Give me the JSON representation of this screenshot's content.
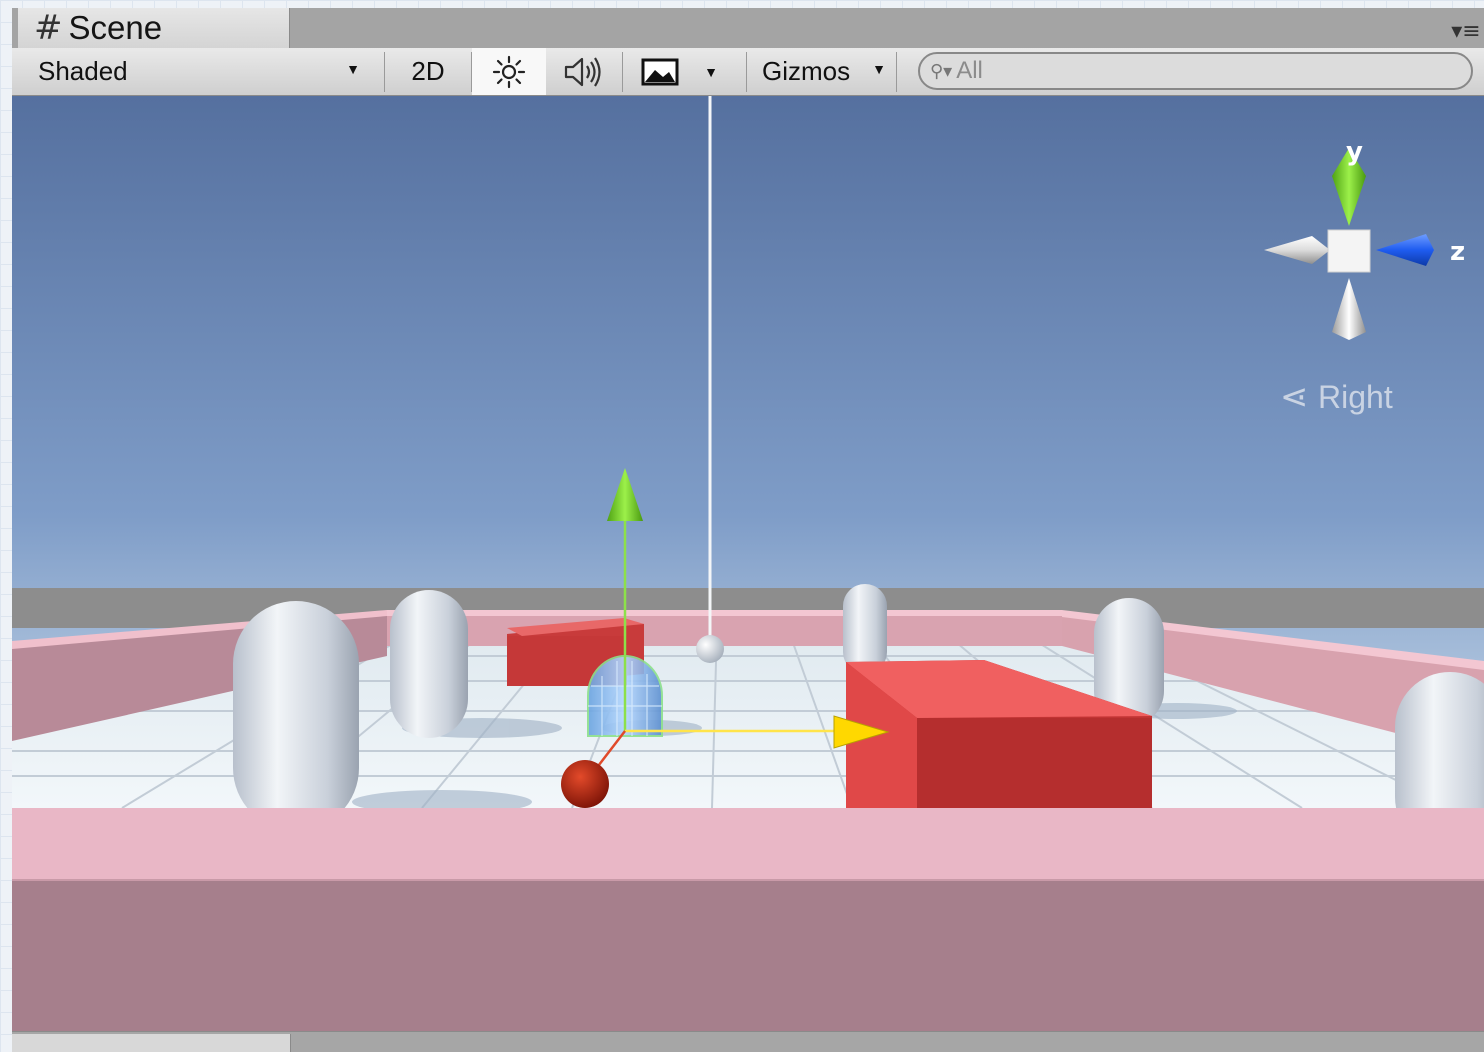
{
  "tab": {
    "title": "Scene",
    "icon": "grid-hash-icon"
  },
  "toolbar": {
    "draw_mode": "Shaded",
    "mode_2d_label": "2D",
    "lighting_icon": "sun-icon",
    "audio_icon": "speaker-icon",
    "effects_icon": "image-icon",
    "gizmos_label": "Gizmos",
    "search_placeholder": "All"
  },
  "gizmo": {
    "y_label": "y",
    "z_label": "z",
    "view_label": "Right",
    "colors": {
      "y": "#7ed321",
      "z": "#2f6bff",
      "neutral": "#dcdcdc"
    }
  },
  "scene": {
    "sky_top": "#5470a0",
    "sky_horizon": "#e8f0f5",
    "floor": "#eef4f8",
    "wall": "#e6a9b9",
    "obstacle": "#e04848",
    "player": "#8fbef0",
    "ball": "#b02010",
    "move_handles": {
      "x": "#ffd800",
      "y": "#7ed321",
      "z": "#e03020"
    }
  }
}
